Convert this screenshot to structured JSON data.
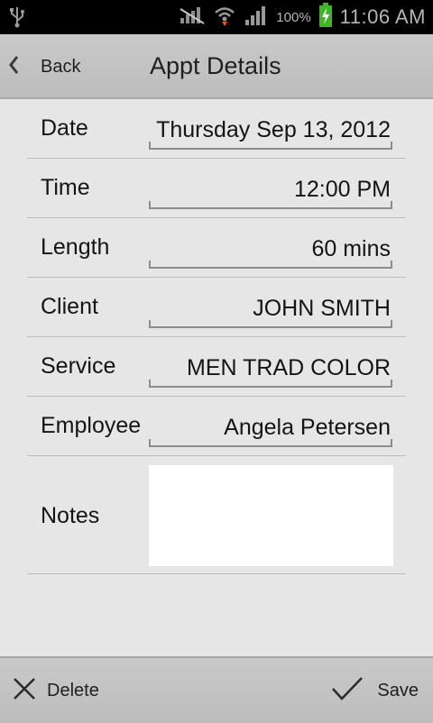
{
  "status_bar": {
    "battery_percent": "100%",
    "time": "11:06 AM"
  },
  "title_bar": {
    "back_label": "Back",
    "title": "Appt Details"
  },
  "form": {
    "date": {
      "label": "Date",
      "value": "Thursday Sep 13, 2012"
    },
    "time": {
      "label": "Time",
      "value": "12:00 PM"
    },
    "length": {
      "label": "Length",
      "value": "60 mins"
    },
    "client": {
      "label": "Client",
      "value": "JOHN SMITH"
    },
    "service": {
      "label": "Service",
      "value": "MEN TRAD COLOR"
    },
    "employee": {
      "label": "Employee",
      "value": "Angela Petersen"
    },
    "notes": {
      "label": "Notes",
      "value": ""
    }
  },
  "actions": {
    "delete_label": "Delete",
    "save_label": "Save"
  }
}
